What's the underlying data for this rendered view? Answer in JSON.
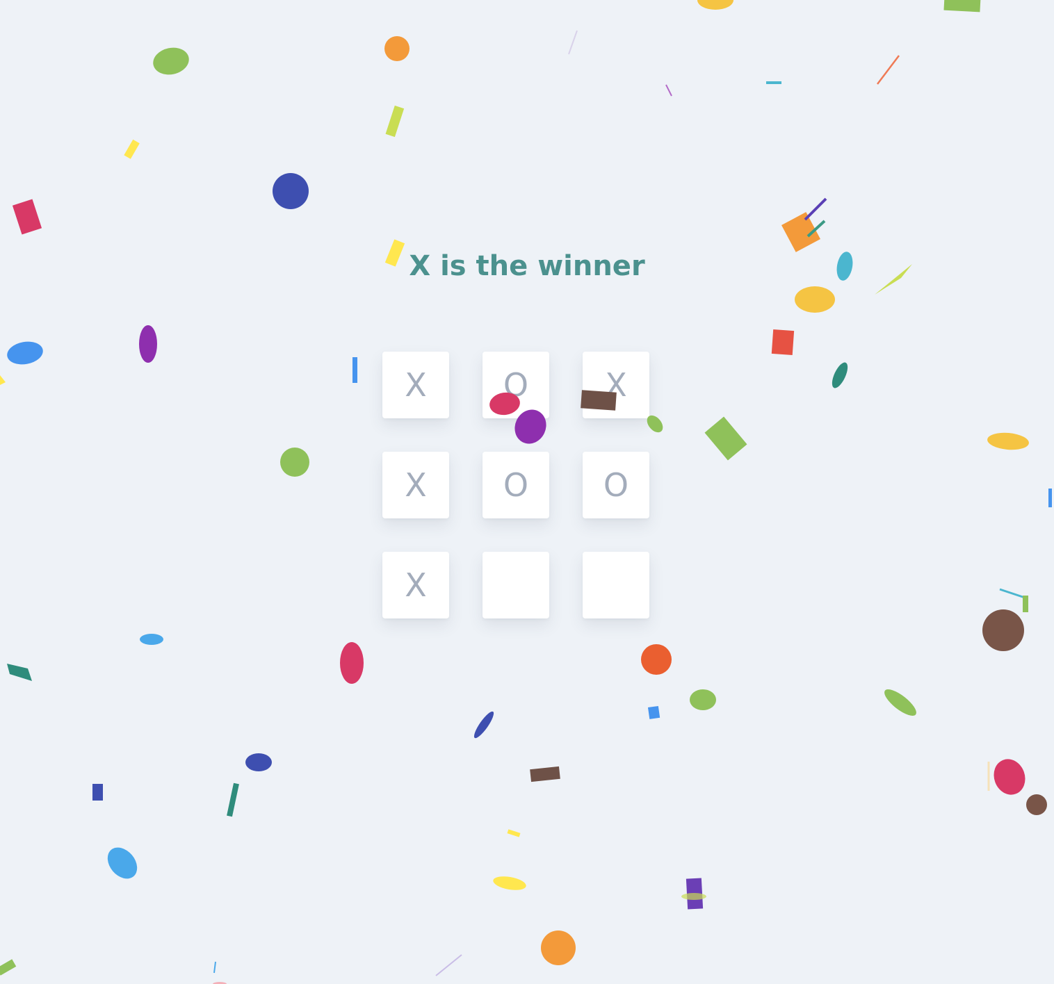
{
  "game": {
    "status": "X is the winner",
    "board": [
      "X",
      "O",
      "X",
      "X",
      "O",
      "O",
      "X",
      "",
      ""
    ]
  },
  "colors": {
    "background": "#eef2f7",
    "status_text": "#4b918e",
    "cell_background": "#ffffff",
    "mark_text": "#a3acbb"
  }
}
